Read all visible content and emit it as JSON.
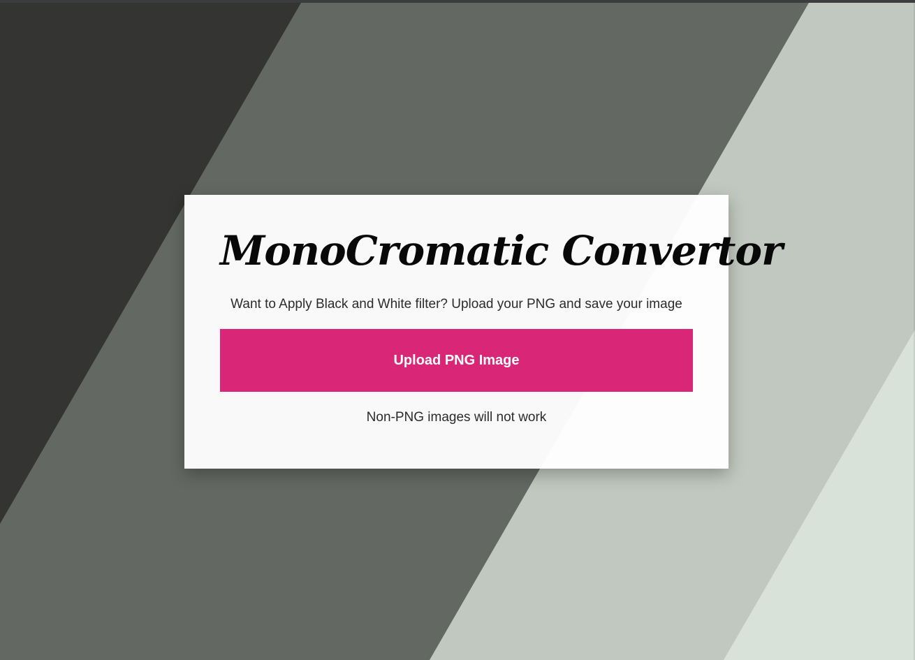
{
  "card": {
    "title": "MonoCromatic Convertor",
    "description": "Want to Apply Black and White filter? Upload your PNG and save your image",
    "upload_button_label": "Upload PNG Image",
    "note": "Non-PNG images will not work"
  },
  "colors": {
    "accent": "#d92677",
    "stripe_dark": "#343433",
    "stripe_mid": "#646863",
    "stripe_light": "#c0c8bf",
    "stripe_lightest": "#d8e2d8",
    "card_bg": "#f8f8f8"
  }
}
